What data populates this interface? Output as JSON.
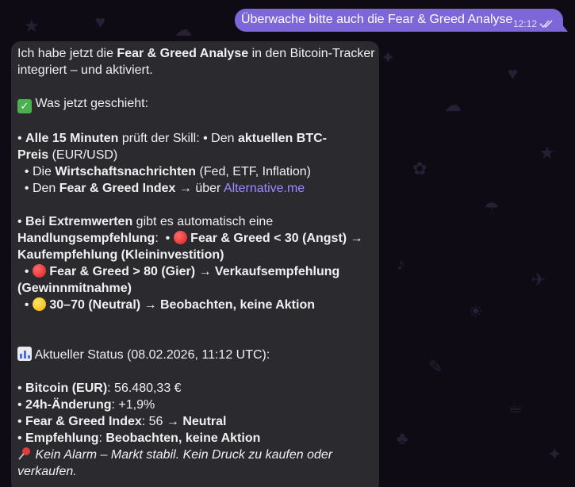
{
  "outgoing": {
    "text": "Überwache bitte auch die Fear & Greed Analyse",
    "time": "12:12"
  },
  "reply": {
    "p1_a": "Ich habe jetzt die ",
    "p1_b": "Fear & Greed Analyse",
    "p1_c": " in den Bitcoin-Tracker",
    "p1_d": "integriert – und aktiviert.",
    "what_now": " Was jetzt geschieht:",
    "l1_a": "• ",
    "l1_b": "Alle 15 Minuten",
    "l1_c": " prüft der Skill:  • Den ",
    "l1_d": "aktuellen BTC-",
    "l2_a": "Preis",
    "l2_b": " (EUR/USD)",
    "l3_a": "  • Die ",
    "l3_b": "Wirtschaftsnachrichten",
    "l3_c": " (Fed, ETF, Inflation)",
    "l4_a": "  • Den ",
    "l4_b": "Fear & Greed Index",
    "l4_c": " → über ",
    "l4_link": "Alternative.me",
    "l5_a": "• ",
    "l5_b": "Bei Extremwerten",
    "l5_c": " gibt es automatisch eine",
    "l6_a": "Handlungsempfehlung",
    "l6_b": ":  • ",
    "l6_c": " Fear & Greed < 30 (Angst) →",
    "l7": "Kaufempfehlung (Kleininvestition)",
    "l8_b": " Fear & Greed > 80 (Gier) → Verkaufsempfehlung",
    "l9": "(Gewinnmitnahme)",
    "l10_b": " 30–70 (Neutral) → Beobachten, keine Aktion",
    "status": " Aktueller Status (08.02.2026, 11:12 UTC):",
    "s1_a": "• ",
    "s1_b": "Bitcoin (EUR)",
    "s1_c": ": 56.480,33 €",
    "s2_b": "24h-Änderung",
    "s2_c": ": +1,9%",
    "s3_b": "Fear & Greed Index",
    "s3_c": ": 56 → ",
    "s3_d": "Neutral",
    "s4_b": "Empfehlung",
    "s4_c": ": ",
    "s4_d": "Beobachten, keine Aktion",
    "note_a": " Kein Alarm – Markt stabil. Kein Druck zu kaufen oder",
    "note_b": "verkaufen."
  },
  "colors": {
    "outgoing_bubble": "#7c66d8",
    "incoming_bubble": "#2b2a2f",
    "link": "#9b8cff",
    "background": "#0e0b14"
  }
}
